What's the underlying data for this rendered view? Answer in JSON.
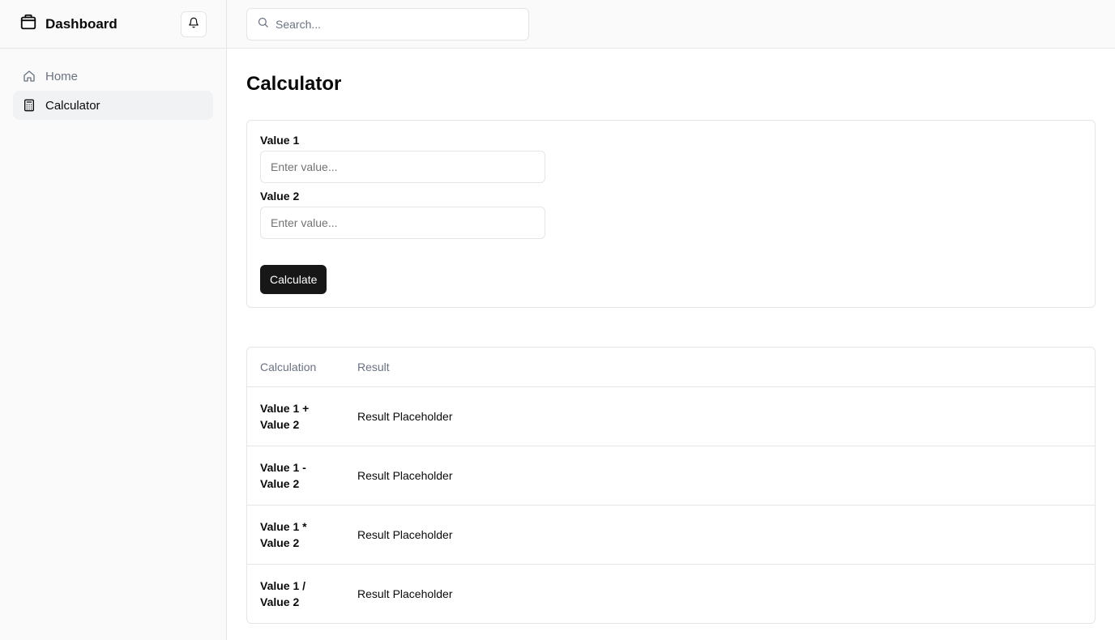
{
  "sidebar": {
    "brand": "Dashboard",
    "items": [
      {
        "label": "Home",
        "icon": "home-icon",
        "active": false
      },
      {
        "label": "Calculator",
        "icon": "calculator-icon",
        "active": true
      }
    ]
  },
  "topbar": {
    "search_placeholder": "Search..."
  },
  "page": {
    "title": "Calculator"
  },
  "form": {
    "value1_label": "Value 1",
    "value1_placeholder": "Enter value...",
    "value1_value": "",
    "value2_label": "Value 2",
    "value2_placeholder": "Enter value...",
    "value2_value": "",
    "button_label": "Calculate"
  },
  "table": {
    "headers": [
      "Calculation",
      "Result"
    ],
    "rows": [
      {
        "calculation": "Value 1 + Value 2",
        "result": "Result Placeholder"
      },
      {
        "calculation": "Value 1 - Value 2",
        "result": "Result Placeholder"
      },
      {
        "calculation": "Value 1 * Value 2",
        "result": "Result Placeholder"
      },
      {
        "calculation": "Value 1 / Value 2",
        "result": "Result Placeholder"
      }
    ]
  },
  "colors": {
    "primary_button": "#171717",
    "sidebar_bg": "#fafafa",
    "border": "#e5e5e5",
    "muted_text": "#6b7280"
  }
}
